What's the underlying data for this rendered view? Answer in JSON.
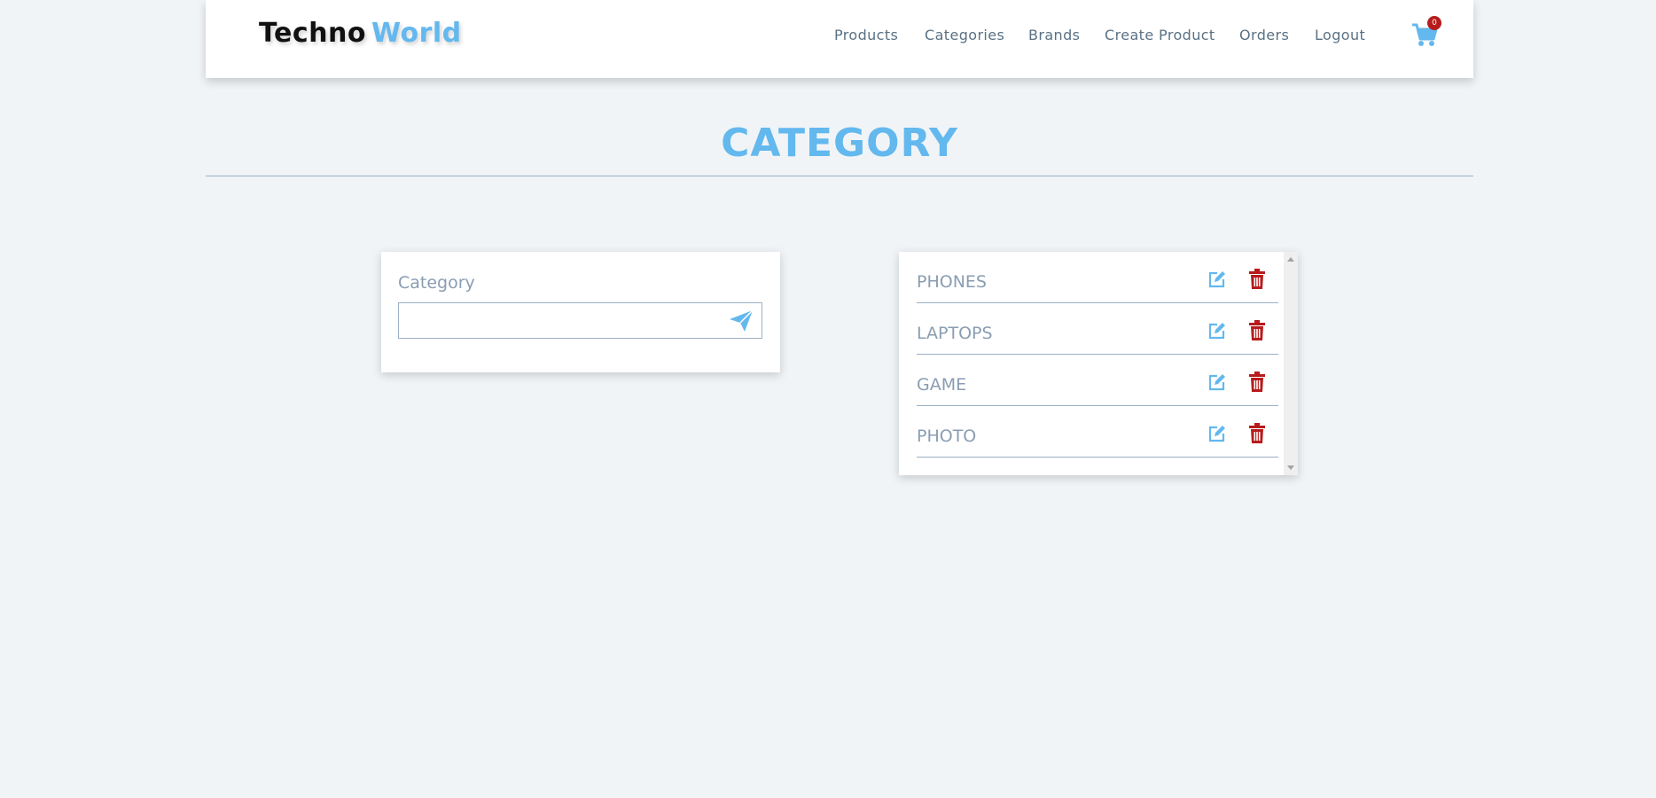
{
  "brand": {
    "part1": "Techno",
    "part2": "World"
  },
  "nav": {
    "links": [
      "Products",
      "Categories",
      "Brands",
      "Create Product",
      "Orders",
      "Logout"
    ],
    "cart_icon": "cart-icon",
    "cart_count": "0"
  },
  "page": {
    "title": "CATEGORY"
  },
  "form": {
    "label": "Category",
    "input_value": "",
    "placeholder": "",
    "submit_icon": "paper-plane-icon"
  },
  "categories": {
    "items": [
      "PHONES",
      "LAPTOPS",
      "GAME",
      "PHOTO"
    ],
    "edit_icon": "edit-icon",
    "delete_icon": "trash-icon"
  },
  "colors": {
    "accent": "#63b8ee",
    "danger": "#b71c1c",
    "background": "#f0f4f7",
    "muted_text": "#8a9db2"
  }
}
